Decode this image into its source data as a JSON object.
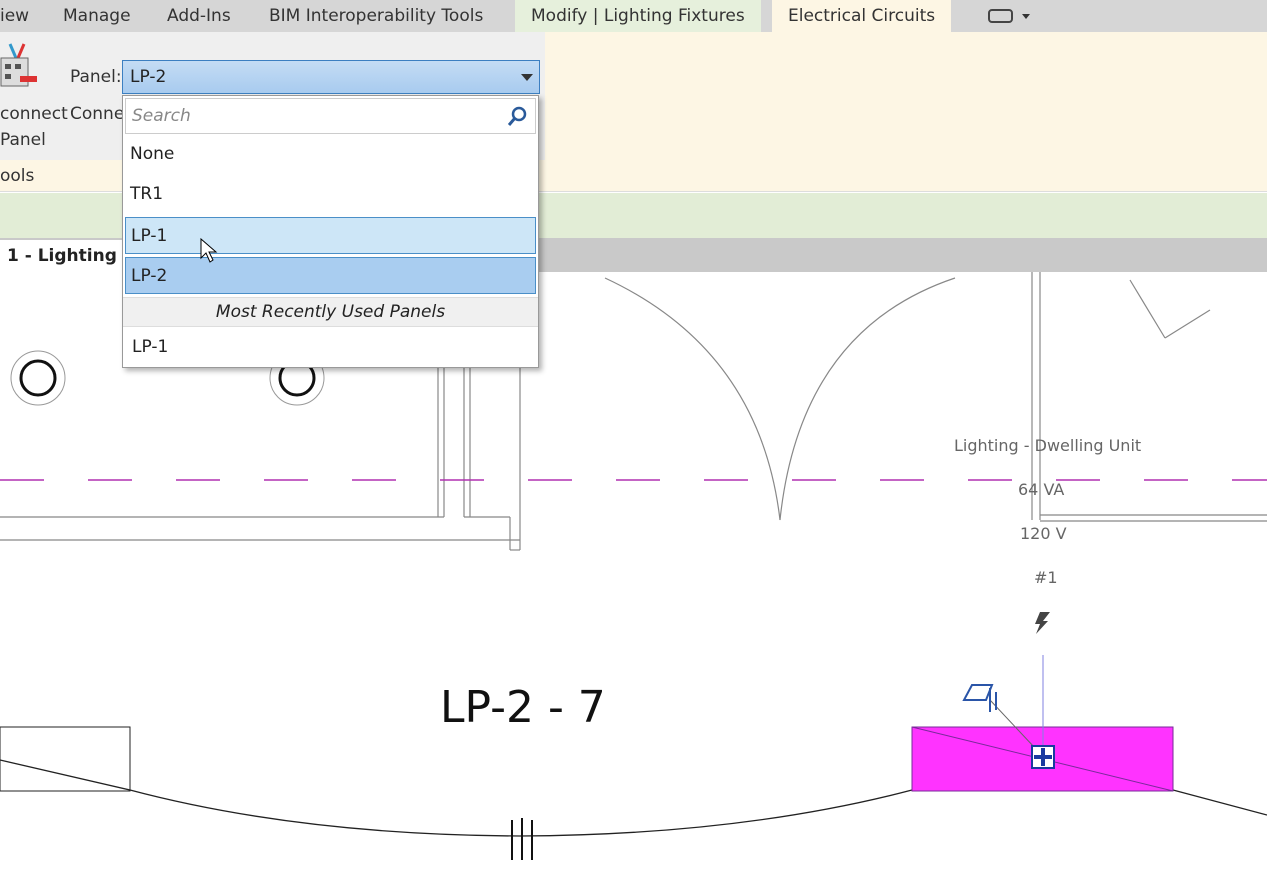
{
  "ribbon_tabs": [
    {
      "label": "iew"
    },
    {
      "label": "Manage"
    },
    {
      "label": "Add-Ins"
    },
    {
      "label": "BIM Interoperability Tools"
    },
    {
      "label": "Modify | Lighting Fixtures"
    },
    {
      "label": "Electrical Circuits"
    }
  ],
  "ribbon": {
    "disconnect_label_1": "connect",
    "disconnect_label_2": "Panel",
    "connect_label": "Conne",
    "panel_label": "Panel:",
    "panel_value": "LP-2",
    "group_label": "ools"
  },
  "dropdown": {
    "search_placeholder": "Search",
    "items": [
      {
        "label": "None"
      },
      {
        "label": "TR1"
      },
      {
        "label": "LP-1"
      },
      {
        "label": "LP-2"
      }
    ],
    "mru_header": "Most Recently Used Panels",
    "mru_items": [
      {
        "label": "LP-1"
      }
    ]
  },
  "view_tab": "1 - Lighting",
  "canvas": {
    "circuit_label": "Lighting - Dwelling Unit",
    "load": "64 VA",
    "voltage": "120 V",
    "circuit_number": "#1",
    "tag": "LP-2 - 7",
    "fixture_color": "#ff33ff"
  }
}
